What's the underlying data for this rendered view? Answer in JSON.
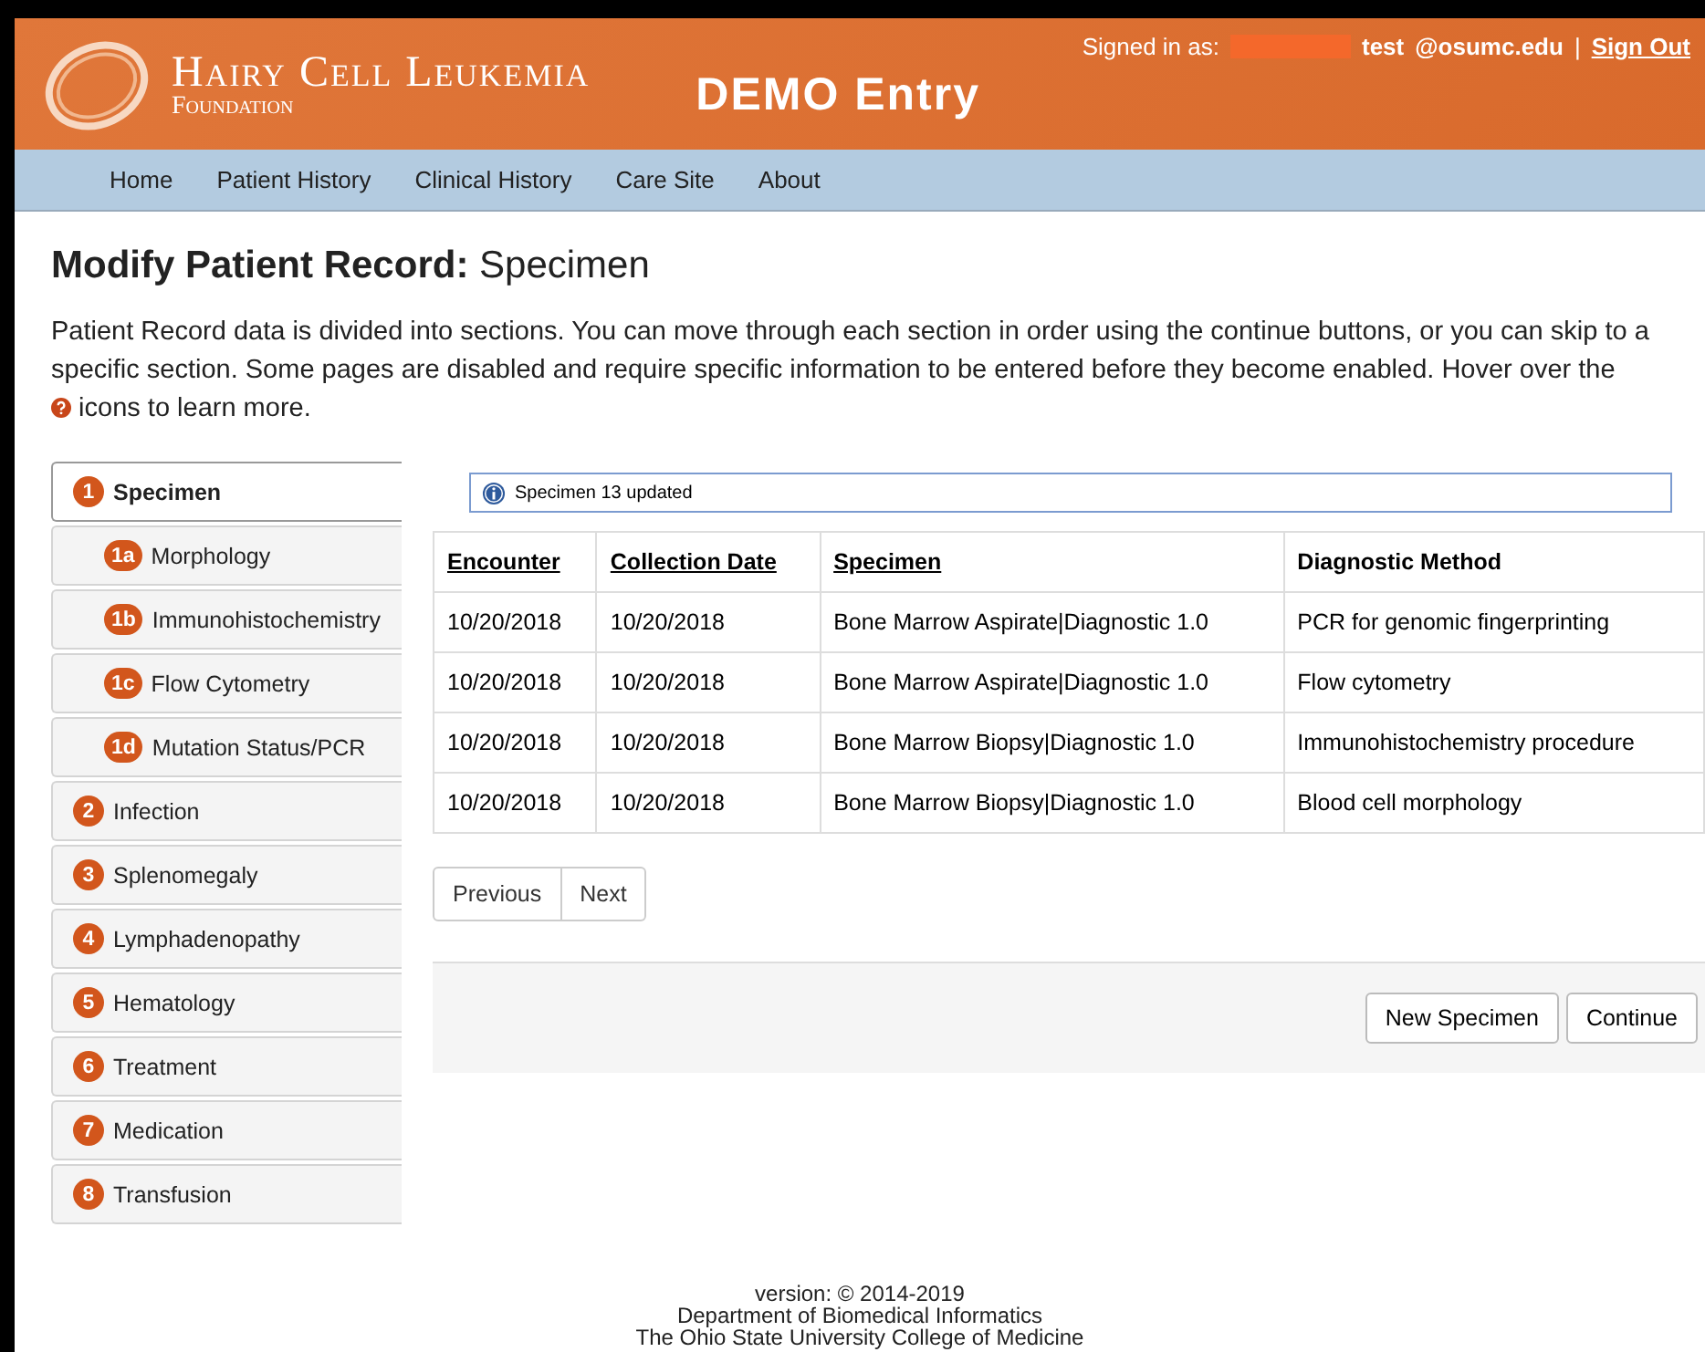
{
  "header": {
    "logo_title": "Hairy Cell Leukemia",
    "logo_subtitle": "Foundation",
    "app_title": "DEMO Entry",
    "signed_in_label": "Signed in as:",
    "user": "test",
    "domain": "@osumc.edu",
    "separator": "|",
    "sign_out": "Sign Out"
  },
  "nav": [
    "Home",
    "Patient History",
    "Clinical History",
    "Care Site",
    "About"
  ],
  "page_title": {
    "bold": "Modify Patient Record:",
    "rest": "Specimen"
  },
  "intro": "Patient Record data is divided into sections. You can move through each section in order using the continue buttons, or you can skip to a specific section. Some pages are disabled and require specific information to be entered before they become enabled. Hover over the",
  "intro_tail": "icons to learn more.",
  "sidebar": [
    {
      "badge": "1",
      "label": "Specimen",
      "kind": "main",
      "selected": true
    },
    {
      "badge": "1a",
      "label": "Morphology",
      "kind": "sub",
      "selected": false
    },
    {
      "badge": "1b",
      "label": "Immunohistochemistry",
      "kind": "sub",
      "selected": false
    },
    {
      "badge": "1c",
      "label": "Flow Cytometry",
      "kind": "sub",
      "selected": false
    },
    {
      "badge": "1d",
      "label": "Mutation Status/PCR",
      "kind": "sub",
      "selected": false
    },
    {
      "badge": "2",
      "label": "Infection",
      "kind": "main",
      "selected": false
    },
    {
      "badge": "3",
      "label": "Splenomegaly",
      "kind": "main",
      "selected": false
    },
    {
      "badge": "4",
      "label": "Lymphadenopathy",
      "kind": "main",
      "selected": false
    },
    {
      "badge": "5",
      "label": "Hematology",
      "kind": "main",
      "selected": false
    },
    {
      "badge": "6",
      "label": "Treatment",
      "kind": "main",
      "selected": false
    },
    {
      "badge": "7",
      "label": "Medication",
      "kind": "main",
      "selected": false
    },
    {
      "badge": "8",
      "label": "Transfusion",
      "kind": "main",
      "selected": false
    }
  ],
  "alert": "Specimen 13 updated",
  "table": {
    "columns": [
      {
        "label": "Encounter",
        "sortable": true
      },
      {
        "label": "Collection Date",
        "sortable": true
      },
      {
        "label": "Specimen",
        "sortable": true
      },
      {
        "label": "Diagnostic Method",
        "sortable": false
      }
    ],
    "rows": [
      [
        "10/20/2018",
        "10/20/2018",
        "Bone Marrow Aspirate|Diagnostic 1.0",
        "PCR for genomic fingerprinting"
      ],
      [
        "10/20/2018",
        "10/20/2018",
        "Bone Marrow Aspirate|Diagnostic 1.0",
        "Flow cytometry"
      ],
      [
        "10/20/2018",
        "10/20/2018",
        "Bone Marrow Biopsy|Diagnostic 1.0",
        "Immunohistochemistry procedure"
      ],
      [
        "10/20/2018",
        "10/20/2018",
        "Bone Marrow Biopsy|Diagnostic 1.0",
        "Blood cell morphology"
      ]
    ]
  },
  "pager": [
    "Previous",
    "Next"
  ],
  "actions": [
    "New Specimen",
    "Continue"
  ],
  "footer": [
    "version: © 2014-2019",
    "Department of Biomedical Informatics",
    "The Ohio State University College of Medicine"
  ]
}
